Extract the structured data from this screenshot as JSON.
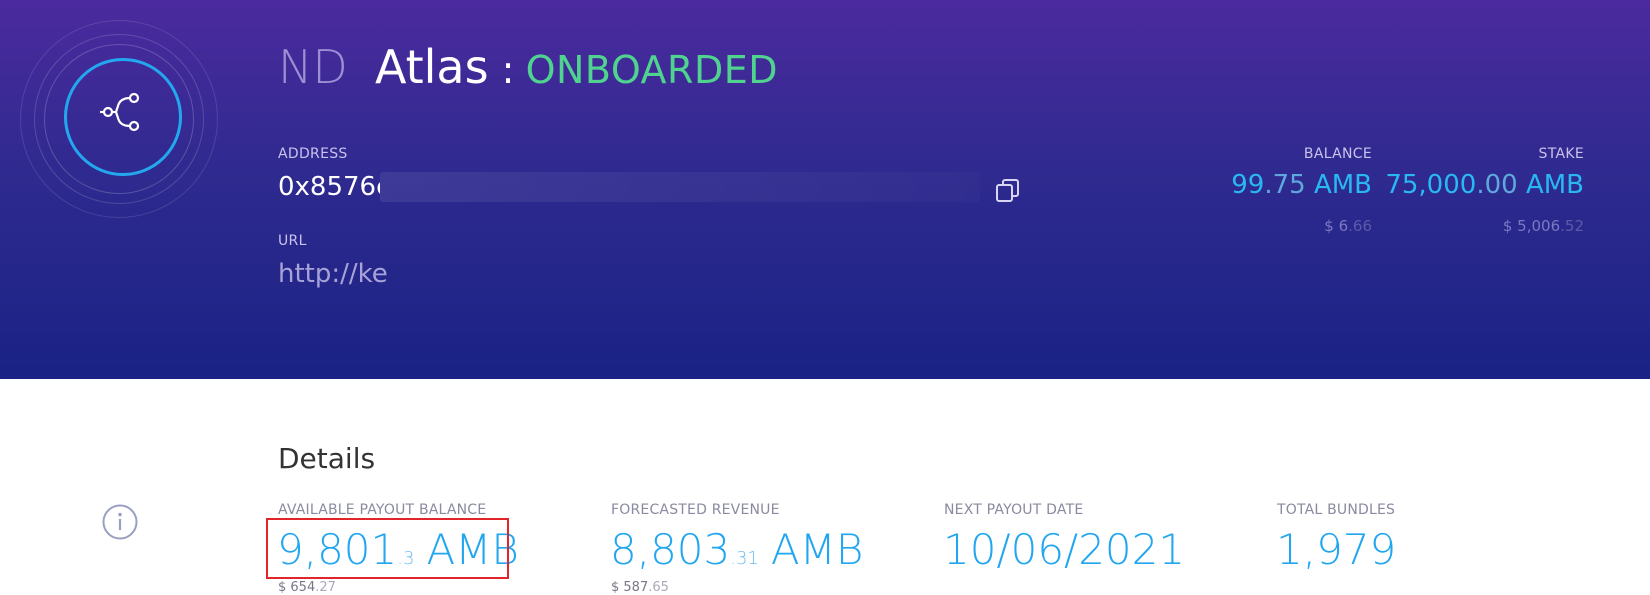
{
  "header": {
    "prefix": "ND",
    "name": "Atlas",
    "separator": ":",
    "status": "ONBOARDED",
    "address_label": "ADDRESS",
    "address_value": "0x8576c",
    "url_label": "URL",
    "url_value": "http://ke",
    "balance": {
      "label": "BALANCE",
      "int": "99",
      "dec": ".75",
      "unit": "AMB",
      "usd_int": "$ 6",
      "usd_dec": ".66"
    },
    "stake": {
      "label": "STAKE",
      "int": "75,000",
      "dec": ".00",
      "unit": "AMB",
      "usd_int": "$ 5,006",
      "usd_dec": ".52"
    }
  },
  "details": {
    "title": "Details",
    "available_payout": {
      "label": "AVAILABLE PAYOUT BALANCE",
      "int": "9,801",
      "dec": ".3",
      "unit": "AMB",
      "usd_int": "$ 654",
      "usd_dec": ".27"
    },
    "forecasted_revenue": {
      "label": "FORECASTED REVENUE",
      "int": "8,803",
      "dec": ".31",
      "unit": "AMB",
      "usd_int": "$ 587",
      "usd_dec": ".65"
    },
    "next_payout_date": {
      "label": "NEXT PAYOUT DATE",
      "value": "10/06/2021"
    },
    "total_bundles": {
      "label": "TOTAL BUNDLES",
      "value": "1,979"
    }
  },
  "colors": {
    "accent": "#22a6ef",
    "status": "#4fd38f",
    "highlight": "#e0262b"
  },
  "icons": [
    "node-share-icon",
    "copy-icon",
    "info-icon"
  ]
}
